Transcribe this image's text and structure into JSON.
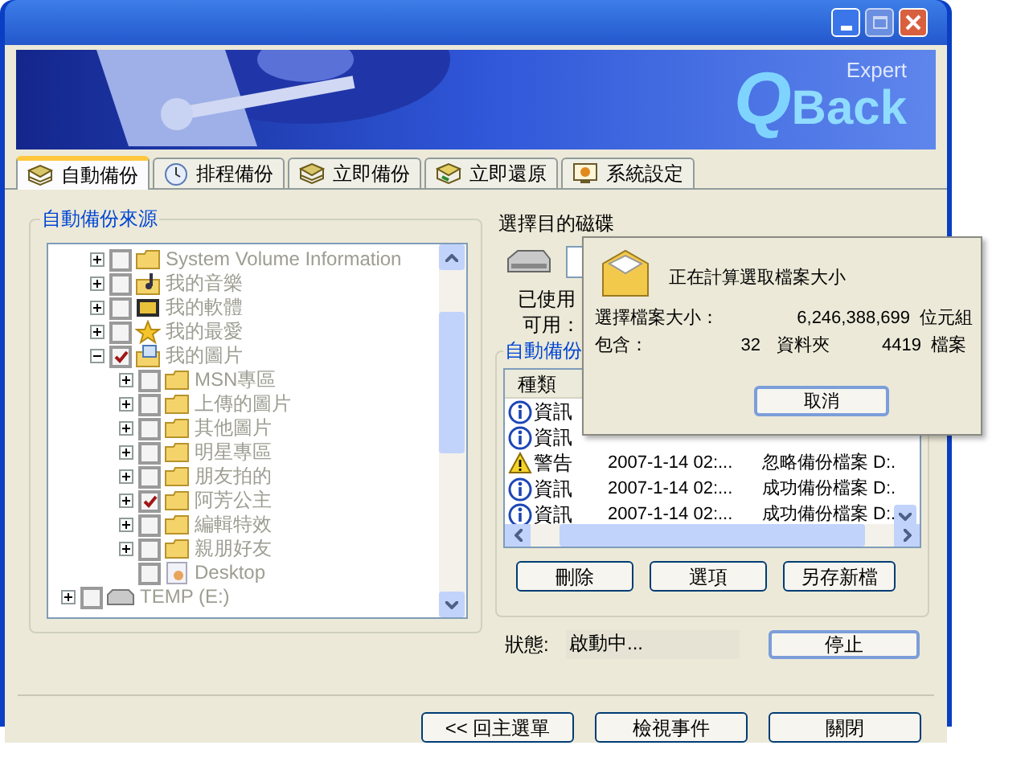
{
  "banner": {
    "logo_letter": "Q",
    "logo_word": "Back",
    "edition": "Expert"
  },
  "tabs": [
    {
      "label": "自動備份",
      "kind": "backup",
      "selected": true
    },
    {
      "label": "排程備份",
      "kind": "clock",
      "selected": false
    },
    {
      "label": "立即備份",
      "kind": "backup",
      "selected": false
    },
    {
      "label": "立即還原",
      "kind": "restore",
      "selected": false
    },
    {
      "label": "系統設定",
      "kind": "settings",
      "selected": false
    }
  ],
  "source": {
    "title": "自動備份來源",
    "disabled": true,
    "tree": [
      {
        "children": [
          {
            "label": "System Volume Information",
            "kind": "folder",
            "expandable": true,
            "expanded": false,
            "checked": false
          },
          {
            "label": "我的音樂",
            "kind": "music",
            "expandable": true,
            "expanded": false,
            "checked": false
          },
          {
            "label": "我的軟體",
            "kind": "software",
            "expandable": true,
            "expanded": false,
            "checked": false
          },
          {
            "label": "我的最愛",
            "kind": "star",
            "expandable": true,
            "expanded": false,
            "checked": false
          },
          {
            "label": "我的圖片",
            "kind": "pictures",
            "expandable": true,
            "expanded": true,
            "checked": true,
            "children": [
              {
                "label": "MSN專區",
                "kind": "folder",
                "expandable": true,
                "expanded": false,
                "checked": false
              },
              {
                "label": "上傳的圖片",
                "kind": "folder",
                "expandable": true,
                "expanded": false,
                "checked": false
              },
              {
                "label": "其他圖片",
                "kind": "folder",
                "expandable": true,
                "expanded": false,
                "checked": false
              },
              {
                "label": "明星專區",
                "kind": "folder",
                "expandable": true,
                "expanded": false,
                "checked": false
              },
              {
                "label": "朋友拍的",
                "kind": "folder",
                "expandable": true,
                "expanded": false,
                "checked": false
              },
              {
                "label": "阿芳公主",
                "kind": "folder",
                "expandable": true,
                "expanded": false,
                "checked": true
              },
              {
                "label": "編輯特效",
                "kind": "folder",
                "expandable": true,
                "expanded": false,
                "checked": false
              },
              {
                "label": "親朋好友",
                "kind": "folder",
                "expandable": true,
                "expanded": false,
                "checked": false
              },
              {
                "label": "Desktop",
                "kind": "desktop",
                "expandable": false,
                "checked": false
              }
            ]
          }
        ]
      },
      {
        "label": "TEMP (E:)",
        "kind": "drive",
        "expandable": true,
        "expanded": false,
        "checked": false
      }
    ]
  },
  "destination": {
    "title": "選擇目的磁碟",
    "used_label": "已使用",
    "free_label": "可用："
  },
  "log": {
    "title": "自動備份",
    "columns": [
      "種類"
    ],
    "rows": [
      {
        "kind": "info",
        "type": "資訊"
      },
      {
        "kind": "info",
        "type": "資訊"
      },
      {
        "kind": "warning",
        "type": "警告",
        "time": "2007-1-14 02:...",
        "message": "忽略備份檔案 D:."
      },
      {
        "kind": "info",
        "type": "資訊",
        "time": "2007-1-14 02:...",
        "message": "成功備份檔案 D:."
      },
      {
        "kind": "info",
        "type": "資訊",
        "time": "2007-1-14 02:...",
        "message": "成功備份檔案 D:."
      }
    ],
    "buttons": [
      "刪除",
      "選項",
      "另存新檔"
    ]
  },
  "status": {
    "label": "狀態:",
    "value": "啟動中...",
    "button": "停止"
  },
  "footer_buttons": [
    "<< 回主選單",
    "檢視事件",
    "關閉"
  ],
  "dialog": {
    "title": "正在計算選取檔案大小",
    "size_label": "選擇檔案大小：",
    "size_value": "6,246,388,699",
    "size_unit": "位元組",
    "contains_label": "包含：",
    "folders": "32",
    "folders_unit": "資料夾",
    "files": "4419",
    "files_unit": "檔案",
    "button": "取消"
  }
}
